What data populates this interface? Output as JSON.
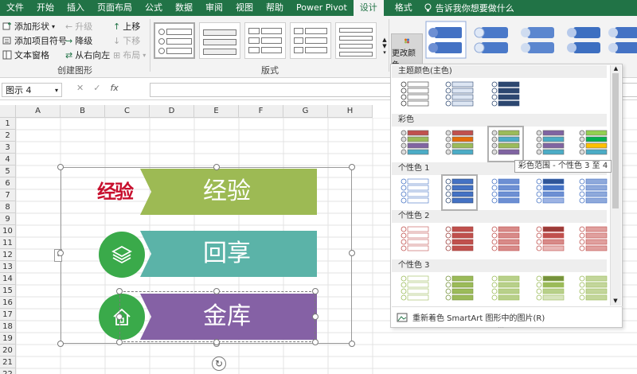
{
  "tabs": [
    {
      "label": "文件",
      "active": false
    },
    {
      "label": "开始",
      "active": false
    },
    {
      "label": "插入",
      "active": false
    },
    {
      "label": "页面布局",
      "active": false
    },
    {
      "label": "公式",
      "active": false
    },
    {
      "label": "数据",
      "active": false
    },
    {
      "label": "审阅",
      "active": false
    },
    {
      "label": "视图",
      "active": false
    },
    {
      "label": "帮助",
      "active": false
    },
    {
      "label": "Power Pivot",
      "active": false
    },
    {
      "label": "设计",
      "active": true
    },
    {
      "label": "格式",
      "active": false
    }
  ],
  "tell_me": "告诉我你想要做什么",
  "ribbon": {
    "add_shape": "添加形状",
    "add_bullet": "添加项目符号",
    "text_pane": "文本窗格",
    "promote": "升级",
    "demote": "降级",
    "right_to_left": "从右向左",
    "move_up": "上移",
    "move_down": "下移",
    "layout_btn": "布局",
    "group_create": "创建图形",
    "group_layout": "版式",
    "change_colors": "更改颜色"
  },
  "name_box": "图示 4",
  "formula_icons": {
    "cancel": "✕",
    "enter": "✓",
    "fx": "fx"
  },
  "columns": [
    "A",
    "B",
    "C",
    "D",
    "E",
    "F",
    "G",
    "H"
  ],
  "rows": [
    "1",
    "2",
    "3",
    "4",
    "5",
    "6",
    "7",
    "8",
    "9",
    "10",
    "11",
    "12",
    "13",
    "14",
    "15",
    "16",
    "17",
    "18",
    "19",
    "20",
    "21",
    "22"
  ],
  "smartart": {
    "logo_text": "经验",
    "items": [
      {
        "text": "经验",
        "color": "#9dba54",
        "icon": "logo"
      },
      {
        "text": "回享",
        "color": "#5bb3a8",
        "icon": "layers-icon"
      },
      {
        "text": "金库",
        "color": "#8561a5",
        "icon": "home-icon"
      }
    ]
  },
  "dropdown": {
    "sections": [
      {
        "title": "主题颜色(主色)"
      },
      {
        "title": "彩色"
      },
      {
        "title": "个性色 1"
      },
      {
        "title": "个性色 2"
      },
      {
        "title": "个性色 3"
      }
    ],
    "tooltip": "彩色范围 - 个性色 3 至 4",
    "footer": "重新着色 SmartArt 图形中的图片(R)"
  },
  "colors": {
    "excel_green": "#217346",
    "theme_dark": "#2c4770",
    "accent1": "#4472c4",
    "accent2": "#c0504d",
    "accent3": "#9bbb59"
  }
}
